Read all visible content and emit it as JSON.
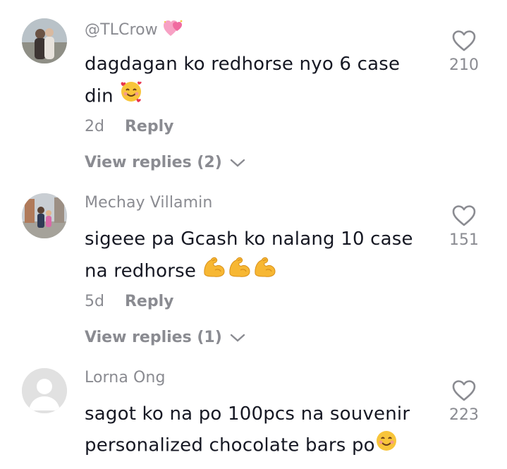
{
  "comments": [
    {
      "username": "@TLCrow",
      "text_line1": "dagdagan ko redhorse nyo 6 case",
      "text_line2": "din",
      "age": "2d",
      "reply_label": "Reply",
      "view_replies": "View replies (2)",
      "likes": "210"
    },
    {
      "username": "Mechay Villamin",
      "text_line1": "sigeee pa Gcash ko nalang 10 case",
      "text_line2": "na redhorse",
      "age": "5d",
      "reply_label": "Reply",
      "view_replies": "View replies (1)",
      "likes": "151"
    },
    {
      "username": "Lorna Ong",
      "text_line1": "sagot ko na po 100pcs na souvenir",
      "text_line2": "personalized chocolate bars po",
      "likes": "223"
    }
  ],
  "colors": {
    "text": "#161823",
    "secondary": "#8a8b91",
    "background": "#ffffff"
  }
}
